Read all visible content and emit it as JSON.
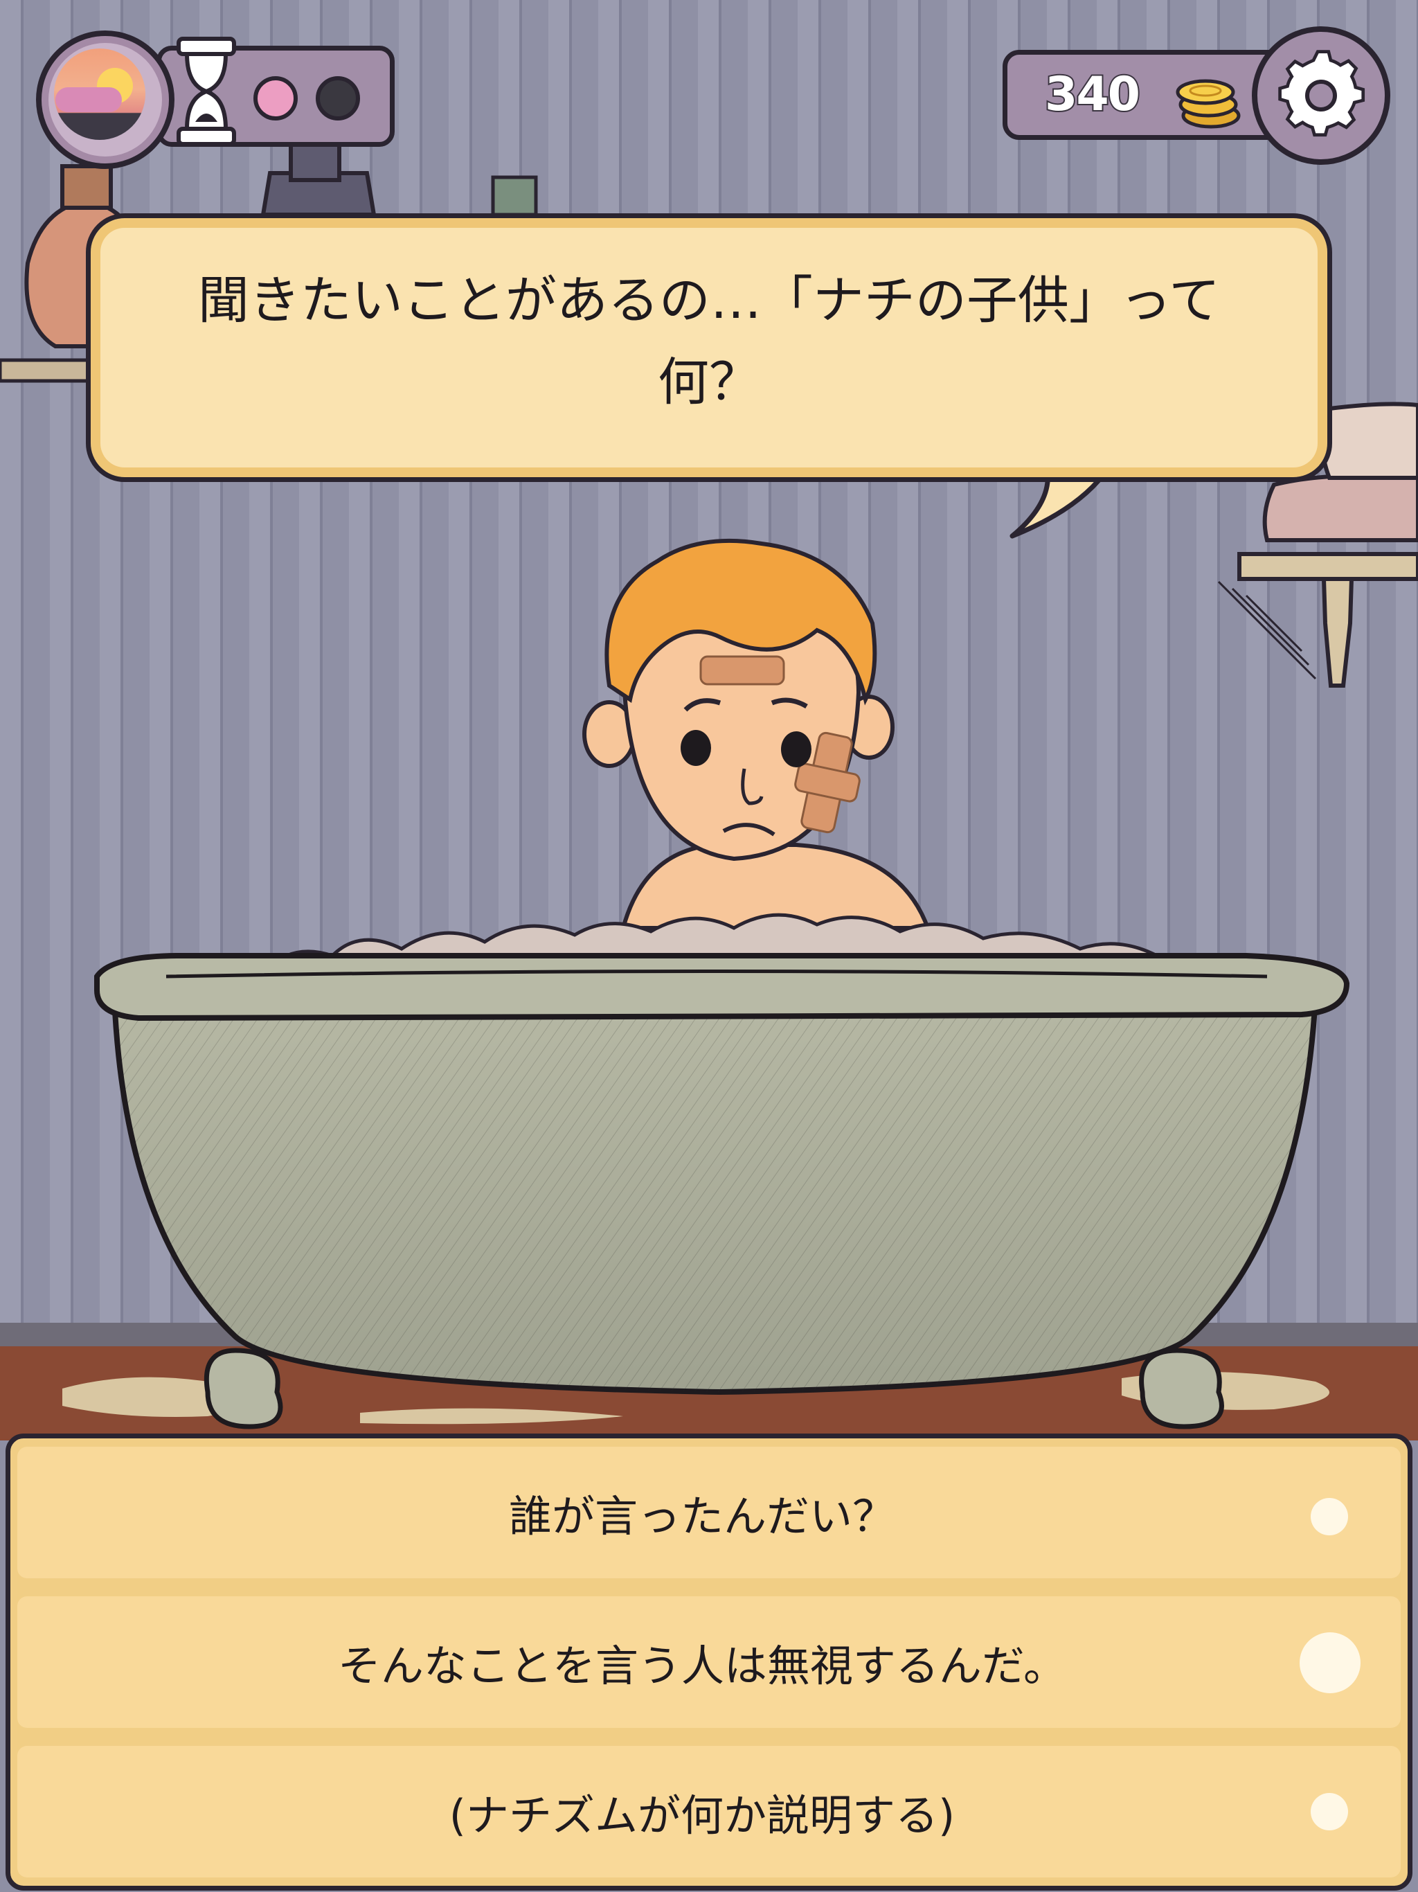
{
  "hud": {
    "coins": "340",
    "time_dots": [
      "pink",
      "dark"
    ],
    "icons": {
      "day": "sunrise-icon",
      "time": "hourglass-icon",
      "coin": "coin-stack-icon",
      "settings": "gear-icon"
    }
  },
  "dialogue": {
    "line1": "聞きたいことがあるの…「ナチの子供」って",
    "line2": "何？"
  },
  "choices": [
    {
      "label": "誰が言ったんだい？",
      "indicator": "small"
    },
    {
      "label": "そんなことを言う人は無視するんだ。",
      "indicator": "large"
    },
    {
      "label": "(ナチズムが何か説明する)",
      "indicator": "small"
    }
  ],
  "colors": {
    "wall": "#8e8fa4",
    "bubble_fill": "#fae3b0",
    "bubble_rim": "#efc675",
    "choice_fill": "#f9d999",
    "hud_panel": "#a28ea8",
    "outline": "#2a2430"
  }
}
